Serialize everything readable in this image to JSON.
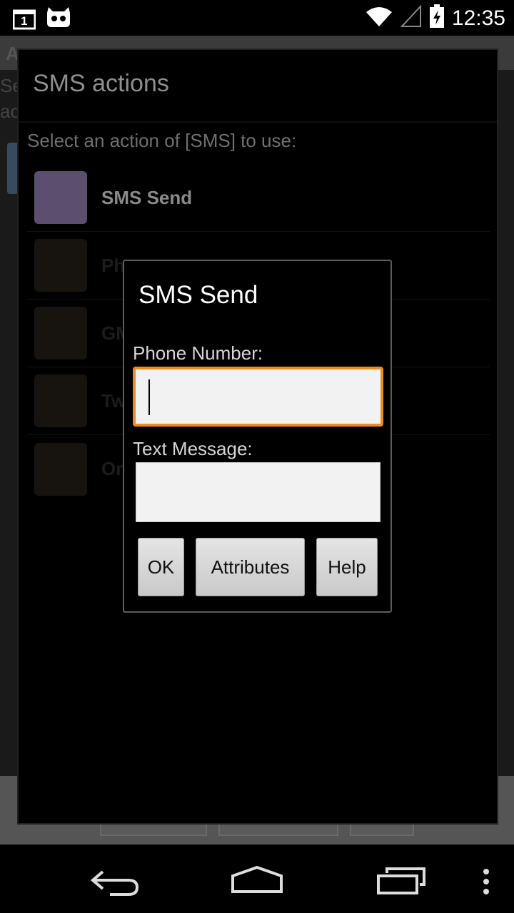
{
  "status_bar": {
    "notification_badge": "1",
    "time": "12:35",
    "icons": [
      "notification-1-icon",
      "cyanogen-mascot-icon",
      "wifi-icon",
      "signal-icon",
      "battery-charging-icon"
    ]
  },
  "outer_dialog": {
    "title": "SMS actions",
    "subtitle": "Select an action of [SMS] to use:",
    "actions": [
      {
        "label": "SMS Send"
      },
      {
        "label": "Ph"
      },
      {
        "label": "GM"
      },
      {
        "label": "Tw"
      },
      {
        "label": "On"
      }
    ]
  },
  "inner_dialog": {
    "title": "SMS Send",
    "phone_label": "Phone Number:",
    "phone_value": "",
    "text_label": "Text Message:",
    "text_value": "",
    "buttons": {
      "ok": "OK",
      "attributes": "Attributes",
      "help": "Help"
    }
  },
  "nav_bar": {
    "icons": [
      "back-icon",
      "home-icon",
      "recent-apps-icon",
      "overflow-menu-icon"
    ]
  },
  "colors": {
    "accent": "#f08c1e",
    "selected_icon": "#5c4e6e"
  }
}
